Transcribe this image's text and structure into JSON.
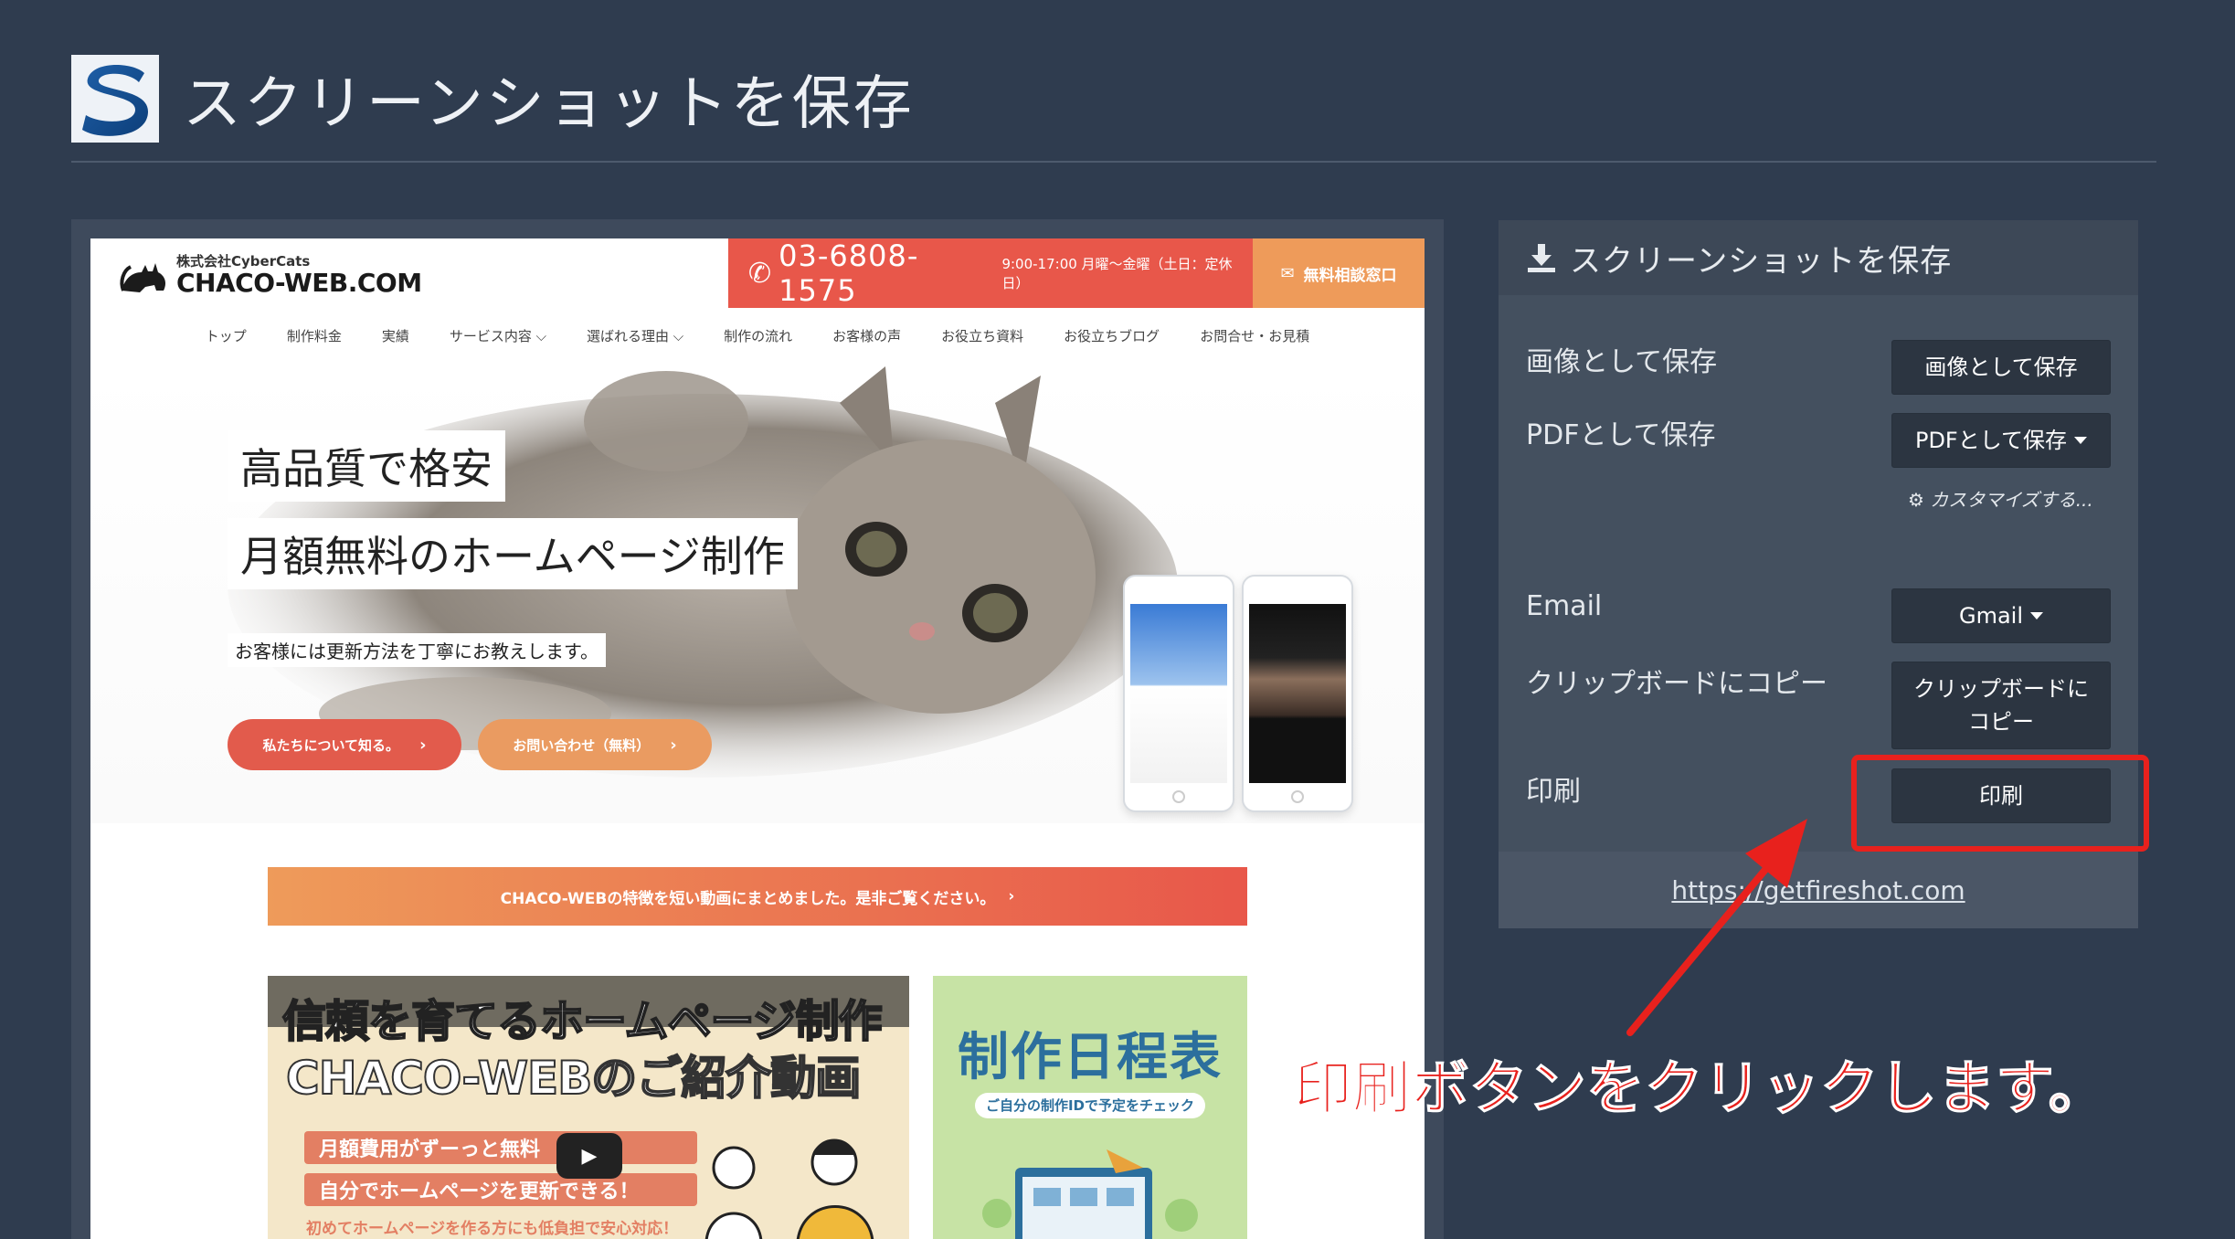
{
  "app": {
    "title": "スクリーンショットを保存"
  },
  "preview": {
    "site": {
      "company": "株式会社CyberCats",
      "brand": "CHACO-WEB.COM",
      "phone": "03-6808-1575",
      "hours": "9:00-17:00 月曜〜金曜（土日：定休日）",
      "consult": "無料相談窓口",
      "nav": [
        "トップ",
        "制作料金",
        "実績",
        "サービス内容 ⌵",
        "選ばれる理由 ⌵",
        "制作の流れ",
        "お客様の声",
        "お役立ち資料",
        "お役立ちブログ",
        "お問合せ・お見積"
      ],
      "hero_line1": "高品質で格安",
      "hero_line2": "月額無料のホームページ制作",
      "hero_line3": "お客様には更新方法を丁寧にお教えします。",
      "btn_about": "私たちについて知る。",
      "btn_contact": "お問い合わせ（無料）",
      "video_banner": "CHACO-WEBの特徴を短い動画にまとめました。是非ご覧ください。",
      "video_title": "信頼を育てるホームページ制作",
      "video_sub": "CHACO-WEBのご紹介動画",
      "video_pill1": "月額費用がずーっと無料",
      "video_pill2": "自分でホームページを更新できる！",
      "video_small": "初めてホームページを作る方にも低負担で安心対応！",
      "schedule_title": "制作日程表",
      "schedule_sub": "ご自分の制作IDで予定をチェック"
    }
  },
  "panel": {
    "title": "スクリーンショットを保存",
    "rows": [
      {
        "label": "画像として保存",
        "button": "画像として保存"
      },
      {
        "label": "PDFとして保存",
        "button": "PDFとして保存"
      },
      {
        "label": "Email",
        "button": "Gmail"
      },
      {
        "label": "クリップボードにコピー",
        "button_line1": "クリップボードに",
        "button_line2": "コピー"
      },
      {
        "label": "印刷",
        "button": "印刷"
      }
    ],
    "customize": "カスタマイズする...",
    "footer_link": "https://getfireshot.com"
  },
  "annotation": {
    "text": "印刷ボタンをクリックします。",
    "color": "#e8211d"
  },
  "colors": {
    "background": "#2f3c4f",
    "panel": "#44505f",
    "button": "#2c3541",
    "accent_red": "#e8574a",
    "accent_orange": "#ee9b5a"
  }
}
